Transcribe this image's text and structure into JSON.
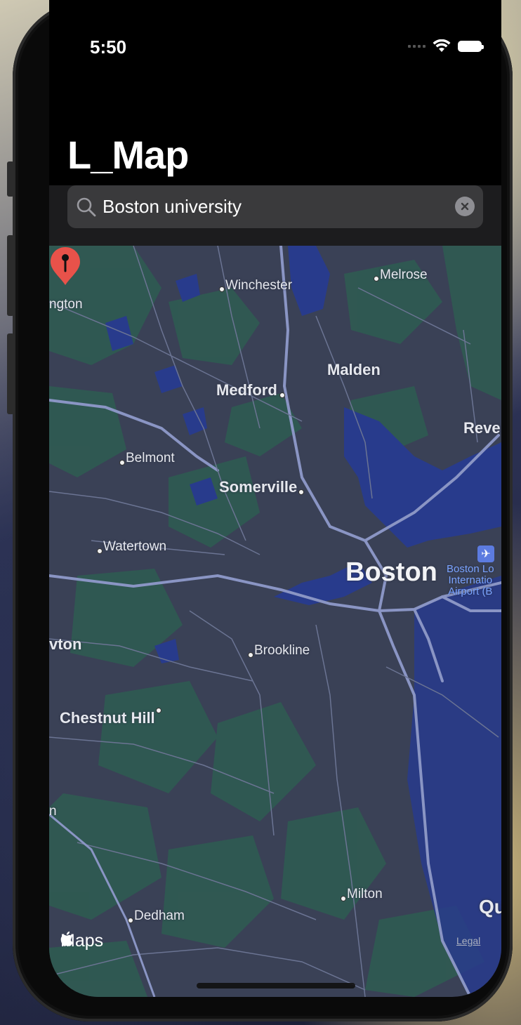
{
  "status_bar": {
    "time": "5:50"
  },
  "nav": {
    "title": "L_Map"
  },
  "search": {
    "value": "Boston university"
  },
  "map": {
    "labels": {
      "winchester": "Winchester",
      "melrose": "Melrose",
      "arlington": "ngton",
      "malden": "Malden",
      "medford": "Medford",
      "revere": "Reve",
      "belmont": "Belmont",
      "somerville": "Somerville",
      "watertown": "Watertown",
      "boston": "Boston",
      "airport": "Boston Lo\nInternatio\nAirport (B",
      "newton": "vton",
      "brookline": "Brookline",
      "chestnut_hill": "Chestnut Hill",
      "milton": "Milton",
      "dedham": "Dedham",
      "quincy": "Qu",
      "edge_n": "n"
    },
    "attribution": "Maps",
    "legal": "Legal",
    "pin_color": "#e8524a"
  },
  "colors": {
    "map_land": "#3a4156",
    "map_water": "#283b8c",
    "map_park": "#2f5a52",
    "accent_blue": "#7aa3ff"
  }
}
